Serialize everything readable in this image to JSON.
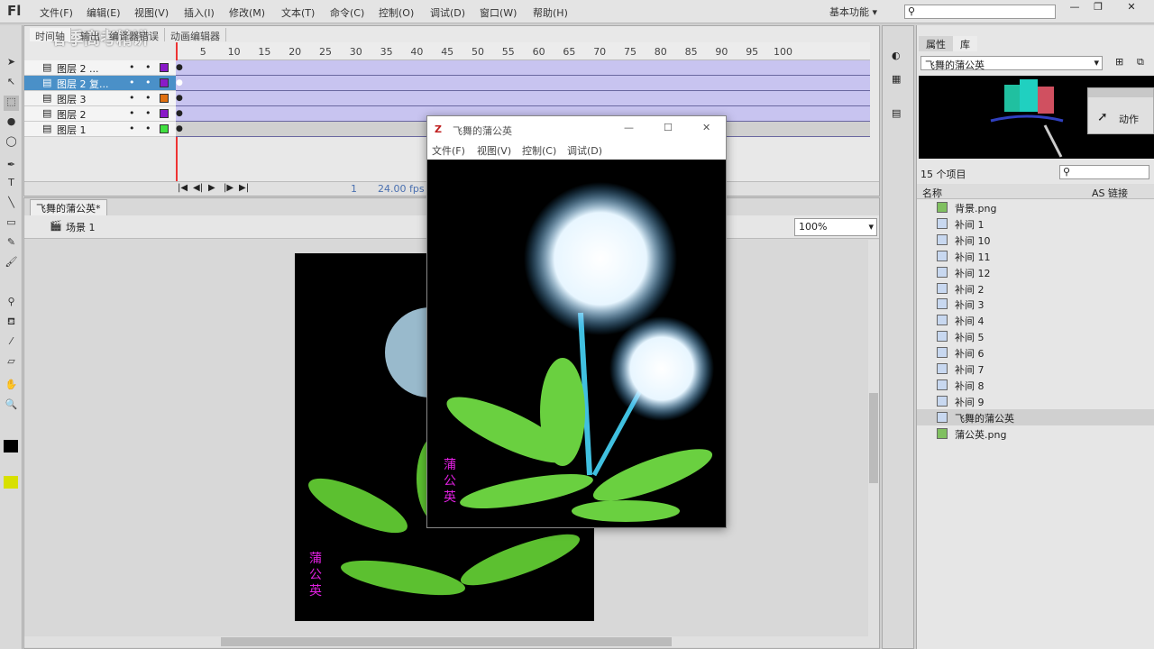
{
  "app": {
    "logo": "Fl",
    "menus": [
      "文件(F)",
      "编辑(E)",
      "视图(V)",
      "插入(I)",
      "修改(M)",
      "文本(T)",
      "命令(C)",
      "控制(O)",
      "调试(D)",
      "窗口(W)",
      "帮助(H)"
    ],
    "workspace": "基本功能 ▾",
    "window_buttons": [
      "—",
      "❐",
      "✕"
    ]
  },
  "timeline": {
    "tabs": [
      "时间轴",
      "输出",
      "编译器错误",
      "动画编辑器"
    ],
    "ruler": [
      "5",
      "10",
      "15",
      "20",
      "25",
      "30",
      "35",
      "40",
      "45",
      "50",
      "55",
      "60",
      "65",
      "70",
      "75",
      "80",
      "85",
      "90",
      "95",
      "100"
    ],
    "layers": [
      {
        "name": "图层 2 ...",
        "color": "#8a1ac8"
      },
      {
        "name": "图层 2 复...",
        "color": "#8a1ac8",
        "selected": true
      },
      {
        "name": "图层 3",
        "color": "#e07010"
      },
      {
        "name": "图层 2",
        "color": "#8a1ac8"
      },
      {
        "name": "图层 1",
        "color": "#40e040"
      }
    ],
    "current_frame": "1",
    "fps": "24.00 fps",
    "controls": [
      "|◀",
      "◀|",
      "▶",
      "|▶",
      "▶|"
    ]
  },
  "document": {
    "tab": "飞舞的蒲公英*",
    "scene": "场景 1",
    "zoom": "100%",
    "stage_text": "蒲公英"
  },
  "library": {
    "tabs": [
      "属性",
      "库"
    ],
    "selected_doc": "飞舞的蒲公英",
    "count": "15 个项目",
    "col_name": "名称",
    "col_link": "AS 链接",
    "items": [
      "背景.png",
      "补间 1",
      "补间 10",
      "补间 11",
      "补间 12",
      "补间 2",
      "补间 3",
      "补间 4",
      "补间 5",
      "补间 6",
      "补间 7",
      "补间 8",
      "补间 9",
      "飞舞的蒲公英",
      "蒲公英.png"
    ],
    "selected": "飞舞的蒲公英"
  },
  "actions_panel": {
    "label": "动作"
  },
  "player": {
    "title": "飞舞的蒲公英",
    "menus": [
      "文件(F)",
      "视图(V)",
      "控制(C)",
      "调试(D)"
    ],
    "buttons": [
      "—",
      "☐",
      "✕"
    ],
    "stage_text": "蒲公英"
  },
  "watermark": "春季高考精讲"
}
